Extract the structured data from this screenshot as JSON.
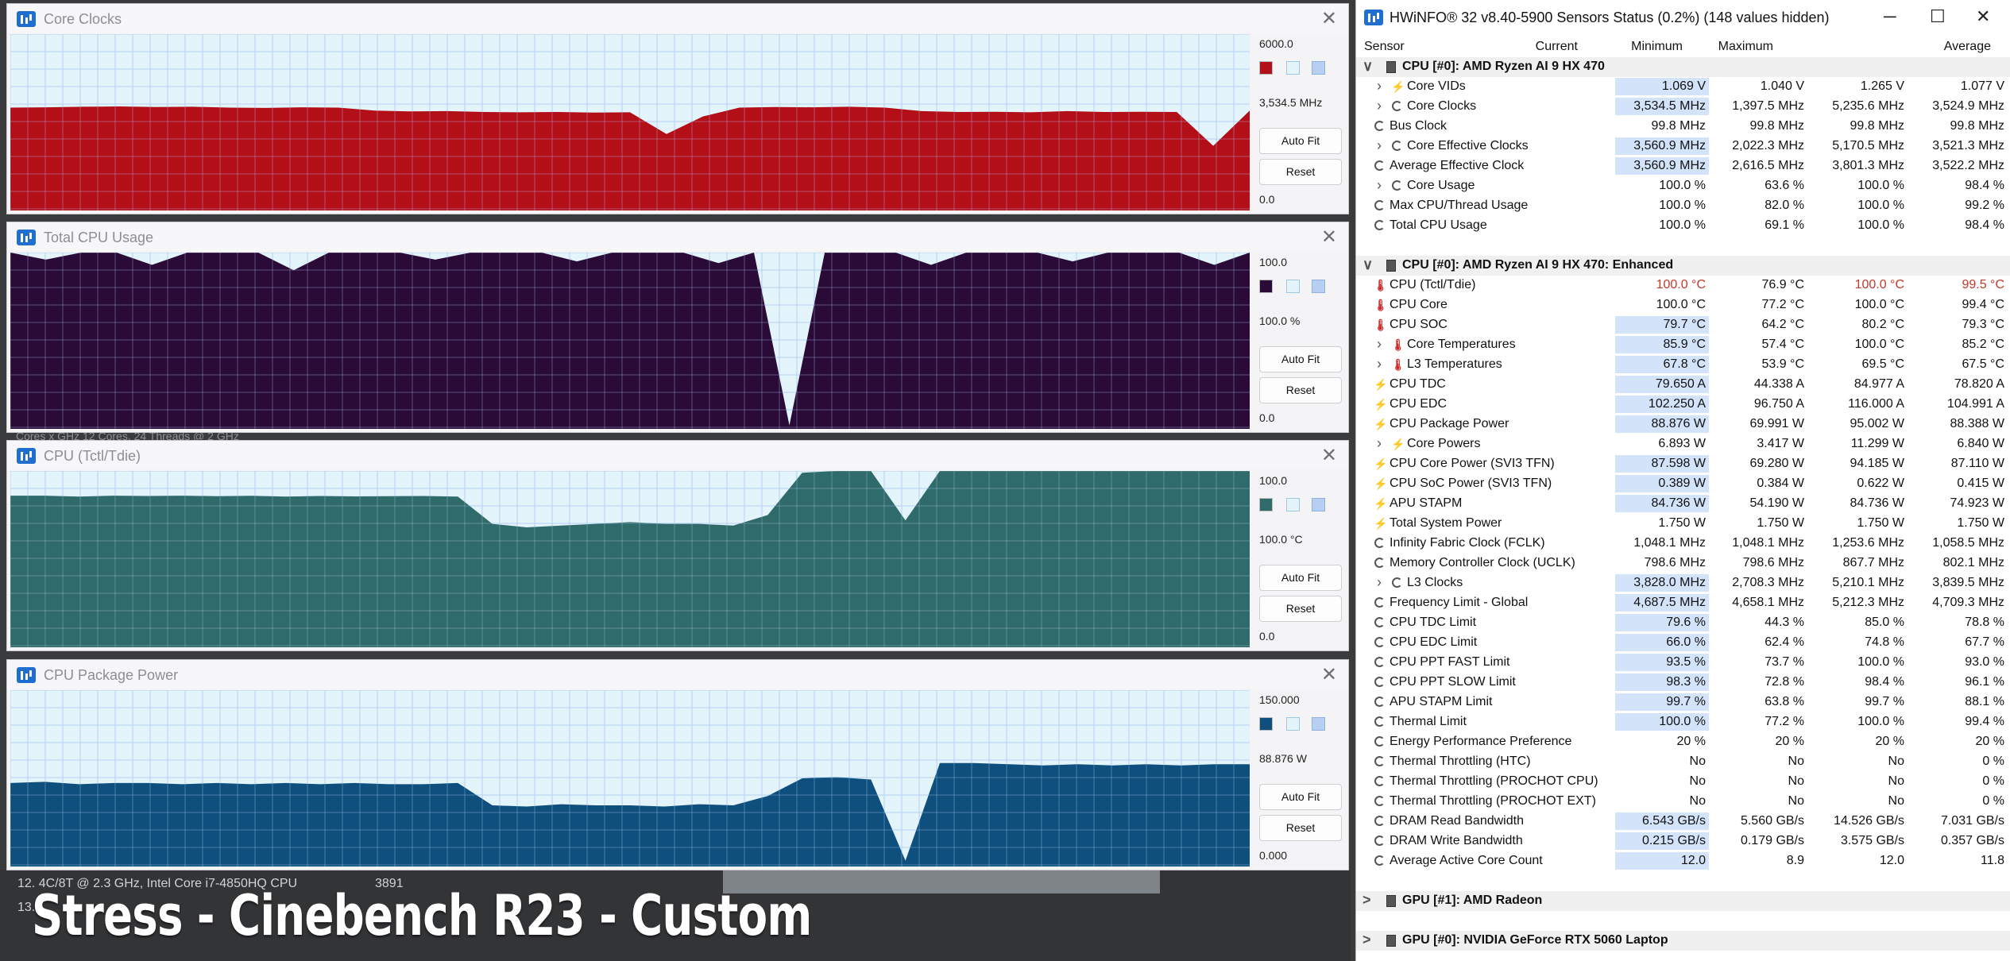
{
  "background": {
    "lines": [
      {
        "text": "12. 4C/8T @ 2.3 GHz, Intel Core i7-4850HQ CPU",
        "num": "3891"
      },
      {
        "text": "13.",
        "num": ""
      }
    ],
    "faint_text": "Cores x GHz   12 Cores, 24 Threads @ 2 GHz",
    "caption": "Stress - Cinebench R23 - Custom"
  },
  "graphs": [
    {
      "title": "Core Clocks",
      "max": "6000.0",
      "current": "3,534.5 MHz",
      "min": "0.0",
      "color": "#b30f18",
      "icon": "close-icon",
      "chart_data": {
        "type": "area",
        "ylim": [
          0,
          6000
        ],
        "samples": [
          3500,
          3510,
          3530,
          3540,
          3520,
          3530,
          3500,
          3490,
          3510,
          3500,
          3400,
          3370,
          3380,
          3350,
          3340,
          3350,
          3330,
          3340,
          2600,
          3200,
          3500,
          3520,
          3510,
          3530,
          3500,
          3380,
          3350,
          3360,
          3340,
          3380,
          3350,
          3360,
          3350,
          2200,
          3400
        ]
      }
    },
    {
      "title": "Total CPU Usage",
      "max": "100.0",
      "current": "100.0 %",
      "min": "0.0",
      "color": "#2a0b38",
      "icon": "close-icon",
      "chart_data": {
        "type": "area",
        "ylim": [
          0,
          100
        ],
        "samples": [
          100,
          96,
          100,
          100,
          93,
          100,
          100,
          100,
          90,
          100,
          100,
          100,
          96,
          100,
          100,
          100,
          95,
          100,
          100,
          100,
          94,
          100,
          2,
          100,
          100,
          100,
          93,
          100,
          100,
          100,
          95,
          100,
          100,
          100,
          93,
          100
        ]
      }
    },
    {
      "title": "CPU (Tctl/Tdie)",
      "max": "100.0",
      "current": "100.0 °C",
      "min": "0.0",
      "color": "#2e6b6a",
      "icon": "close-icon",
      "chart_data": {
        "type": "area",
        "ylim": [
          0,
          100
        ],
        "samples": [
          86,
          86,
          85.5,
          86,
          85.8,
          86,
          85.7,
          85.9,
          85.5,
          85.8,
          85.6,
          85.7,
          85.8,
          85.5,
          70,
          68,
          69,
          70,
          71,
          70,
          70,
          69,
          75,
          99,
          100,
          100,
          72,
          100,
          100,
          100,
          100,
          100,
          100,
          100,
          100,
          100,
          100
        ]
      }
    },
    {
      "title": "CPU Package Power",
      "max": "150.000",
      "current": "88.876 W",
      "min": "0.000",
      "color": "#0f4f7e",
      "icon": "close-icon",
      "chart_data": {
        "type": "area",
        "ylim": [
          0,
          150
        ],
        "samples": [
          71,
          72,
          70,
          71,
          71,
          70,
          71,
          70,
          71,
          70,
          71,
          70,
          70,
          71,
          52,
          51,
          53,
          52,
          52,
          51,
          53,
          52,
          60,
          75,
          76,
          74,
          5,
          88,
          88,
          87,
          86,
          87,
          86,
          87,
          86,
          87,
          87
        ]
      }
    }
  ],
  "buttons": {
    "autofit": "Auto Fit",
    "reset": "Reset"
  },
  "hwinfo": {
    "title": "HWiNFO® 32 v8.40-5900 Sensors Status (0.2%) (148 values hidden)",
    "headers": {
      "sensor": "Sensor",
      "current": "Current",
      "minimum": "Minimum",
      "maximum": "Maximum",
      "average": "Average"
    },
    "rows": [
      {
        "type": "group",
        "name": "CPU [#0]: AMD Ryzen AI 9 HX 470",
        "expander": "∨"
      },
      {
        "type": "row",
        "name": "Core VIDs",
        "icon": "bolt",
        "expand": true,
        "cur": "1.069 V",
        "min": "1.040 V",
        "max": "1.265 V",
        "avg": "1.077 V",
        "hl": true
      },
      {
        "type": "row",
        "name": "Core Clocks",
        "icon": "clock",
        "expand": true,
        "cur": "3,534.5 MHz",
        "min": "1,397.5 MHz",
        "max": "5,235.6 MHz",
        "avg": "3,524.9 MHz",
        "hl": true
      },
      {
        "type": "row",
        "name": "Bus Clock",
        "icon": "clock",
        "expand": false,
        "cur": "99.8 MHz",
        "min": "99.8 MHz",
        "max": "99.8 MHz",
        "avg": "99.8 MHz",
        "hl": false
      },
      {
        "type": "row",
        "name": "Core Effective Clocks",
        "icon": "clock",
        "expand": true,
        "cur": "3,560.9 MHz",
        "min": "2,022.3 MHz",
        "max": "5,170.5 MHz",
        "avg": "3,521.3 MHz",
        "hl": true
      },
      {
        "type": "row",
        "name": "Average Effective Clock",
        "icon": "clock",
        "expand": false,
        "cur": "3,560.9 MHz",
        "min": "2,616.5 MHz",
        "max": "3,801.3 MHz",
        "avg": "3,522.2 MHz",
        "hl": true
      },
      {
        "type": "row",
        "name": "Core Usage",
        "icon": "clock",
        "expand": true,
        "cur": "100.0 %",
        "min": "63.6 %",
        "max": "100.0 %",
        "avg": "98.4 %",
        "hl": false
      },
      {
        "type": "row",
        "name": "Max CPU/Thread Usage",
        "icon": "clock",
        "expand": false,
        "cur": "100.0 %",
        "min": "82.0 %",
        "max": "100.0 %",
        "avg": "99.2 %",
        "hl": false
      },
      {
        "type": "row",
        "name": "Total CPU Usage",
        "icon": "clock",
        "expand": false,
        "cur": "100.0 %",
        "min": "69.1 %",
        "max": "100.0 %",
        "avg": "98.4 %",
        "hl": false
      },
      {
        "type": "blank"
      },
      {
        "type": "group",
        "name": "CPU [#0]: AMD Ryzen AI 9 HX 470: Enhanced",
        "expander": "∨"
      },
      {
        "type": "row",
        "name": "CPU (Tctl/Tdie)",
        "icon": "therm",
        "expand": false,
        "cur": "100.0 °C",
        "min": "76.9 °C",
        "max": "100.0 °C",
        "avg": "99.5 °C",
        "hl": false,
        "hot": true
      },
      {
        "type": "row",
        "name": "CPU Core",
        "icon": "therm",
        "expand": false,
        "cur": "100.0 °C",
        "min": "77.2 °C",
        "max": "100.0 °C",
        "avg": "99.4 °C",
        "hl": false
      },
      {
        "type": "row",
        "name": "CPU SOC",
        "icon": "therm",
        "expand": false,
        "cur": "79.7 °C",
        "min": "64.2 °C",
        "max": "80.2 °C",
        "avg": "79.3 °C",
        "hl": true
      },
      {
        "type": "row",
        "name": "Core Temperatures",
        "icon": "therm",
        "expand": true,
        "cur": "85.9 °C",
        "min": "57.4 °C",
        "max": "100.0 °C",
        "avg": "85.2 °C",
        "hl": true
      },
      {
        "type": "row",
        "name": "L3 Temperatures",
        "icon": "therm",
        "expand": true,
        "cur": "67.8 °C",
        "min": "53.9 °C",
        "max": "69.5 °C",
        "avg": "67.5 °C",
        "hl": true
      },
      {
        "type": "row",
        "name": "CPU TDC",
        "icon": "bolt",
        "expand": false,
        "cur": "79.650 A",
        "min": "44.338 A",
        "max": "84.977 A",
        "avg": "78.820 A",
        "hl": true
      },
      {
        "type": "row",
        "name": "CPU EDC",
        "icon": "bolt",
        "expand": false,
        "cur": "102.250 A",
        "min": "96.750 A",
        "max": "116.000 A",
        "avg": "104.991 A",
        "hl": true
      },
      {
        "type": "row",
        "name": "CPU Package Power",
        "icon": "bolt",
        "expand": false,
        "cur": "88.876 W",
        "min": "69.991 W",
        "max": "95.002 W",
        "avg": "88.388 W",
        "hl": true
      },
      {
        "type": "row",
        "name": "Core Powers",
        "icon": "bolt",
        "expand": true,
        "cur": "6.893 W",
        "min": "3.417 W",
        "max": "11.299 W",
        "avg": "6.840 W",
        "hl": false
      },
      {
        "type": "row",
        "name": "CPU Core Power (SVI3 TFN)",
        "icon": "bolt",
        "expand": false,
        "cur": "87.598 W",
        "min": "69.280 W",
        "max": "94.185 W",
        "avg": "87.110 W",
        "hl": true
      },
      {
        "type": "row",
        "name": "CPU SoC Power (SVI3 TFN)",
        "icon": "bolt",
        "expand": false,
        "cur": "0.389 W",
        "min": "0.384 W",
        "max": "0.622 W",
        "avg": "0.415 W",
        "hl": true
      },
      {
        "type": "row",
        "name": "APU STAPM",
        "icon": "bolt",
        "expand": false,
        "cur": "84.736 W",
        "min": "54.190 W",
        "max": "84.736 W",
        "avg": "74.923 W",
        "hl": true
      },
      {
        "type": "row",
        "name": "Total System Power",
        "icon": "bolt",
        "expand": false,
        "cur": "1.750 W",
        "min": "1.750 W",
        "max": "1.750 W",
        "avg": "1.750 W",
        "hl": false
      },
      {
        "type": "row",
        "name": "Infinity Fabric Clock (FCLK)",
        "icon": "clock",
        "expand": false,
        "cur": "1,048.1 MHz",
        "min": "1,048.1 MHz",
        "max": "1,253.6 MHz",
        "avg": "1,058.5 MHz",
        "hl": false
      },
      {
        "type": "row",
        "name": "Memory Controller Clock (UCLK)",
        "icon": "clock",
        "expand": false,
        "cur": "798.6 MHz",
        "min": "798.6 MHz",
        "max": "867.7 MHz",
        "avg": "802.1 MHz",
        "hl": false
      },
      {
        "type": "row",
        "name": "L3 Clocks",
        "icon": "clock",
        "expand": true,
        "cur": "3,828.0 MHz",
        "min": "2,708.3 MHz",
        "max": "5,210.1 MHz",
        "avg": "3,839.5 MHz",
        "hl": true
      },
      {
        "type": "row",
        "name": "Frequency Limit - Global",
        "icon": "clock",
        "expand": false,
        "cur": "4,687.5 MHz",
        "min": "4,658.1 MHz",
        "max": "5,212.3 MHz",
        "avg": "4,709.3 MHz",
        "hl": true
      },
      {
        "type": "row",
        "name": "CPU TDC Limit",
        "icon": "clock",
        "expand": false,
        "cur": "79.6 %",
        "min": "44.3 %",
        "max": "85.0 %",
        "avg": "78.8 %",
        "hl": true
      },
      {
        "type": "row",
        "name": "CPU EDC Limit",
        "icon": "clock",
        "expand": false,
        "cur": "66.0 %",
        "min": "62.4 %",
        "max": "74.8 %",
        "avg": "67.7 %",
        "hl": true
      },
      {
        "type": "row",
        "name": "CPU PPT FAST Limit",
        "icon": "clock",
        "expand": false,
        "cur": "93.5 %",
        "min": "73.7 %",
        "max": "100.0 %",
        "avg": "93.0 %",
        "hl": true
      },
      {
        "type": "row",
        "name": "CPU PPT SLOW Limit",
        "icon": "clock",
        "expand": false,
        "cur": "98.3 %",
        "min": "72.8 %",
        "max": "98.4 %",
        "avg": "96.1 %",
        "hl": true
      },
      {
        "type": "row",
        "name": "APU STAPM Limit",
        "icon": "clock",
        "expand": false,
        "cur": "99.7 %",
        "min": "63.8 %",
        "max": "99.7 %",
        "avg": "88.1 %",
        "hl": true
      },
      {
        "type": "row",
        "name": "Thermal Limit",
        "icon": "clock",
        "expand": false,
        "cur": "100.0 %",
        "min": "77.2 %",
        "max": "100.0 %",
        "avg": "99.4 %",
        "hl": true
      },
      {
        "type": "row",
        "name": "Energy Performance Preference",
        "icon": "clock",
        "expand": false,
        "cur": "20 %",
        "min": "20 %",
        "max": "20 %",
        "avg": "20 %",
        "hl": false
      },
      {
        "type": "row",
        "name": "Thermal Throttling (HTC)",
        "icon": "clock",
        "expand": false,
        "cur": "No",
        "min": "No",
        "max": "No",
        "avg": "0 %",
        "hl": false
      },
      {
        "type": "row",
        "name": "Thermal Throttling (PROCHOT CPU)",
        "icon": "clock",
        "expand": false,
        "cur": "No",
        "min": "No",
        "max": "No",
        "avg": "0 %",
        "hl": false
      },
      {
        "type": "row",
        "name": "Thermal Throttling (PROCHOT EXT)",
        "icon": "clock",
        "expand": false,
        "cur": "No",
        "min": "No",
        "max": "No",
        "avg": "0 %",
        "hl": false
      },
      {
        "type": "row",
        "name": "DRAM Read Bandwidth",
        "icon": "clock",
        "expand": false,
        "cur": "6.543 GB/s",
        "min": "5.560 GB/s",
        "max": "14.526 GB/s",
        "avg": "7.031 GB/s",
        "hl": true
      },
      {
        "type": "row",
        "name": "DRAM Write Bandwidth",
        "icon": "clock",
        "expand": false,
        "cur": "0.215 GB/s",
        "min": "0.179 GB/s",
        "max": "3.575 GB/s",
        "avg": "0.357 GB/s",
        "hl": true
      },
      {
        "type": "row",
        "name": "Average Active Core Count",
        "icon": "clock",
        "expand": false,
        "cur": "12.0",
        "min": "8.9",
        "max": "12.0",
        "avg": "11.8",
        "hl": true
      },
      {
        "type": "blank"
      },
      {
        "type": "group",
        "name": "GPU [#1]: AMD Radeon",
        "expander": ">"
      },
      {
        "type": "blank"
      },
      {
        "type": "group",
        "name": "GPU [#0]: NVIDIA GeForce RTX 5060 Laptop",
        "expander": ">"
      }
    ]
  }
}
